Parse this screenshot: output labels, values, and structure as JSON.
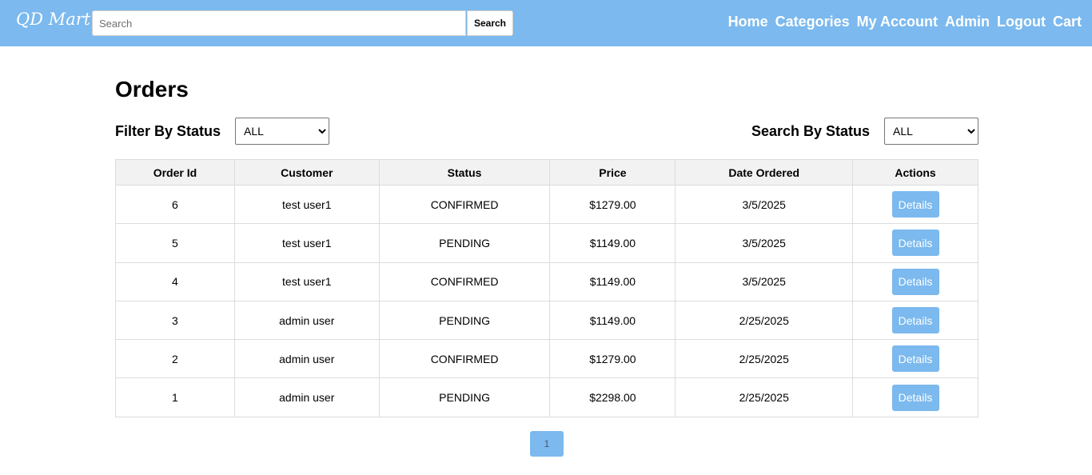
{
  "navbar": {
    "brand": "QD Mart",
    "search_placeholder": "Search",
    "search_button": "Search",
    "links": [
      "Home",
      "Categories",
      "My Account",
      "Admin",
      "Logout",
      "Cart"
    ]
  },
  "page": {
    "title": "Orders",
    "filter_label": "Filter By Status",
    "filter_value": "ALL",
    "search_status_label": "Search By Status",
    "search_status_value": "ALL"
  },
  "table": {
    "headers": [
      "Order Id",
      "Customer",
      "Status",
      "Price",
      "Date Ordered",
      "Actions"
    ],
    "rows": [
      {
        "id": "6",
        "customer": "test user1",
        "status": "CONFIRMED",
        "price": "$1279.00",
        "date": "3/5/2025",
        "action": "Details"
      },
      {
        "id": "5",
        "customer": "test user1",
        "status": "PENDING",
        "price": "$1149.00",
        "date": "3/5/2025",
        "action": "Details"
      },
      {
        "id": "4",
        "customer": "test user1",
        "status": "CONFIRMED",
        "price": "$1149.00",
        "date": "3/5/2025",
        "action": "Details"
      },
      {
        "id": "3",
        "customer": "admin user",
        "status": "PENDING",
        "price": "$1149.00",
        "date": "2/25/2025",
        "action": "Details"
      },
      {
        "id": "2",
        "customer": "admin user",
        "status": "CONFIRMED",
        "price": "$1279.00",
        "date": "2/25/2025",
        "action": "Details"
      },
      {
        "id": "1",
        "customer": "admin user",
        "status": "PENDING",
        "price": "$2298.00",
        "date": "2/25/2025",
        "action": "Details"
      }
    ]
  },
  "pagination": {
    "current_page": "1"
  },
  "colors": {
    "accent": "#7bb9ee",
    "header_bg": "#f2f2f2",
    "border": "#dcdcdc"
  }
}
